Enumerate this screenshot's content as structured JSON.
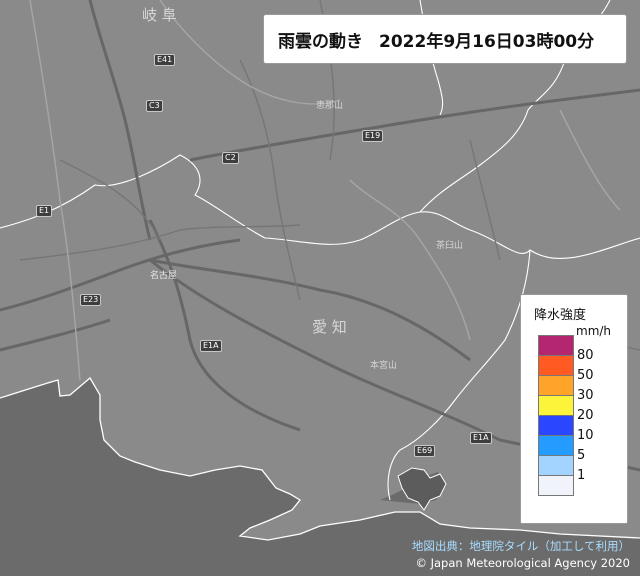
{
  "title": {
    "label": "雨雲の動き",
    "datetime": "2022年9月16日03時00分"
  },
  "legend": {
    "title": "降水強度",
    "unit": "mm/h",
    "items": [
      {
        "label": "80",
        "color": "#b4266f"
      },
      {
        "label": "50",
        "color": "#ff5a22"
      },
      {
        "label": "30",
        "color": "#ffa428"
      },
      {
        "label": "20",
        "color": "#fbf43a"
      },
      {
        "label": "10",
        "color": "#2a46ff"
      },
      {
        "label": "5",
        "color": "#239bff"
      },
      {
        "label": "1",
        "color": "#a2d4ff"
      },
      {
        "label": "",
        "color": "#f1f3fb"
      }
    ]
  },
  "credit": {
    "source": "地図出典：地理院タイル（加工して利用）",
    "copyright": "© Japan Meteorological Agency 2020"
  },
  "map": {
    "prefectures": {
      "gifu": "岐 阜",
      "aichi": "愛 知"
    },
    "cities": {
      "nagoya": "名古屋"
    },
    "mountains": [
      "恵那山",
      "茶臼山",
      "本宮山"
    ],
    "roads": [
      "E41",
      "C3",
      "E19",
      "C2",
      "E1",
      "E1A",
      "E23",
      "E69",
      "E1A"
    ]
  },
  "colors": {
    "land": "#8a8a8a",
    "sea": "#6a6a6a",
    "coastline": "#ffffff",
    "roads": "#686868",
    "rivers": "#a4a4a4"
  }
}
